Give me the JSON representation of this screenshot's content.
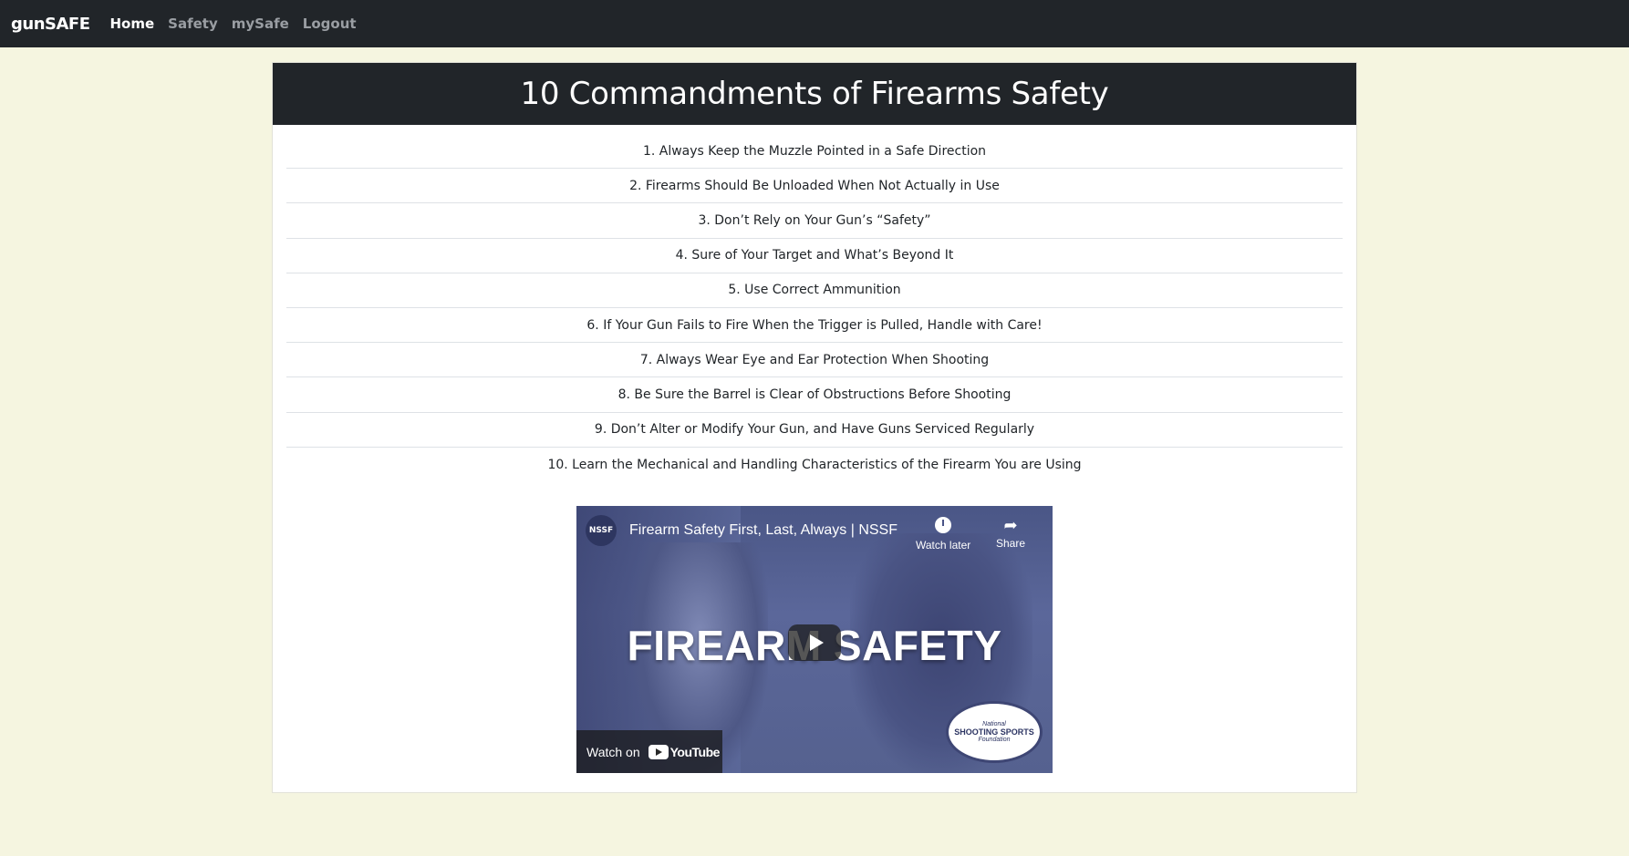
{
  "navbar": {
    "brand": "gunSAFE",
    "links": [
      {
        "label": "Home",
        "active": true
      },
      {
        "label": "Safety",
        "active": false
      },
      {
        "label": "mySafe",
        "active": false
      },
      {
        "label": "Logout",
        "active": false
      }
    ]
  },
  "colors": {
    "page_background": "#f5f5e0",
    "navbar_background": "#212529",
    "header_background": "#212529",
    "nav_active": "#ffffff",
    "nav_inactive": "#9a9ea3"
  },
  "card": {
    "title": "10 Commandments of Firearms Safety",
    "commandments": [
      "1. Always Keep the Muzzle Pointed in a Safe Direction",
      "2. Firearms Should Be Unloaded When Not Actually in Use",
      "3. Don’t Rely on Your Gun’s “Safety”",
      "4. Sure of Your Target and What’s Beyond It",
      "5. Use Correct Ammunition",
      "6. If Your Gun Fails to Fire When the Trigger is Pulled, Handle with Care!",
      "7. Always Wear Eye and Ear Protection When Shooting",
      "8. Be Sure the Barrel is Clear of Obstructions Before Shooting",
      "9. Don’t Alter or Modify Your Gun, and Have Guns Serviced Regularly",
      "10. Learn the Mechanical and Handling Characteristics of the Firearm You are Using"
    ]
  },
  "video": {
    "channel_avatar_text": "NSSF",
    "title": "Firearm Safety First, Last, Always | NSSF",
    "watch_later_label": "Watch later",
    "share_label": "Share",
    "overlay_text": "FIREARM SAFETY",
    "watch_on_label": "Watch on",
    "youtube_wordmark": "YouTube",
    "logo_line1": "National",
    "logo_line2": "SHOOTING SPORTS",
    "logo_line3": "Foundation"
  }
}
